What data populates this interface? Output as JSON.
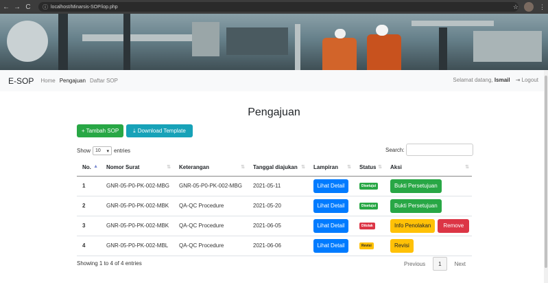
{
  "browser": {
    "url": "localhost/Minarsis-SOP/iop.php"
  },
  "navbar": {
    "brand": "E-SOP",
    "links": [
      "Home",
      "Pengajuan",
      "Daftar SOP"
    ],
    "greeting": "Selamat datang,",
    "username": "Ismail",
    "logout": "Logout"
  },
  "page": {
    "title": "Pengajuan",
    "add_button": "+ Tambah SOP",
    "download_button": "Download Template",
    "show_label": "Show",
    "show_value": "10",
    "entries_label": "entries",
    "search_label": "Search:",
    "info": "Showing 1 to 4 of 4 entries",
    "pagination": {
      "previous": "Previous",
      "current": "1",
      "next": "Next"
    }
  },
  "table": {
    "columns": [
      "No.",
      "Nomor Surat",
      "Keterangan",
      "Tanggal diajukan",
      "Lampiran",
      "Status",
      "Aksi"
    ],
    "rows": [
      {
        "no": "1",
        "nomor": "GNR-05-P0-PK-002-MBG",
        "ket": "GNR-05-P0-PK-002-MBG",
        "tgl": "2021-05-11",
        "lampiran": "Lihat Detail",
        "status": "Disetujui",
        "aksi1": "Bukti Persetujuan",
        "aksi2": ""
      },
      {
        "no": "2",
        "nomor": "GNR-05-P0-PK-002-MBK",
        "ket": "QA-QC Procedure",
        "tgl": "2021-05-20",
        "lampiran": "Lihat Detail",
        "status": "Disetujui",
        "aksi1": "Bukti Persetujuan",
        "aksi2": ""
      },
      {
        "no": "3",
        "nomor": "GNR-05-P0-PK-002-MBK",
        "ket": "QA-QC Procedure",
        "tgl": "2021-06-05",
        "lampiran": "Lihat Detail",
        "status": "Ditolak",
        "aksi1": "Info Penolakan",
        "aksi2": "Remove"
      },
      {
        "no": "4",
        "nomor": "GNR-05-P0-PK-002-MBL",
        "ket": "QA-QC Procedure",
        "tgl": "2021-06-06",
        "lampiran": "Lihat Detail",
        "status": "Revisi",
        "aksi1": "Revisi",
        "aksi2": ""
      }
    ]
  },
  "colors": {
    "primary": "#007bff",
    "success": "#28a745",
    "info": "#17a2b8",
    "warning": "#ffc107",
    "danger": "#dc3545"
  }
}
